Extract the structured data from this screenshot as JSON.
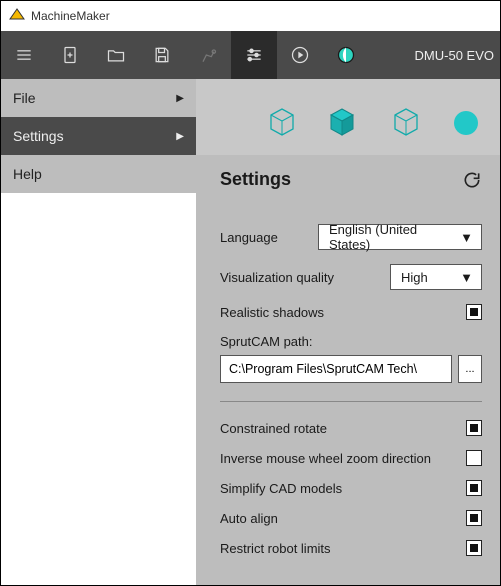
{
  "app": {
    "title": "MachineMaker",
    "project": "DMU-50 EVO"
  },
  "menu": {
    "items": [
      {
        "label": "File",
        "has_sub": true,
        "selected": false
      },
      {
        "label": "Settings",
        "has_sub": true,
        "selected": true
      },
      {
        "label": "Help",
        "has_sub": false,
        "selected": false
      }
    ]
  },
  "panel": {
    "title": "Settings",
    "language_label": "Language",
    "language_value": "English (United States)",
    "vis_quality_label": "Visualization quality",
    "vis_quality_value": "High",
    "realistic_shadows_label": "Realistic shadows",
    "realistic_shadows_checked": true,
    "sprutcam_path_label": "SprutCAM path:",
    "sprutcam_path_value": "C:\\Program Files\\SprutCAM Tech\\",
    "browse_btn": "...",
    "constrained_rotate_label": "Constrained rotate",
    "constrained_rotate_checked": true,
    "inverse_wheel_label": "Inverse mouse wheel zoom direction",
    "inverse_wheel_checked": false,
    "simplify_cad_label": "Simplify CAD models",
    "simplify_cad_checked": true,
    "auto_align_label": "Auto align",
    "auto_align_checked": true,
    "restrict_robot_label": "Restrict robot limits",
    "restrict_robot_checked": true
  },
  "icons": {
    "caret": "▼",
    "submenu": "▶"
  }
}
